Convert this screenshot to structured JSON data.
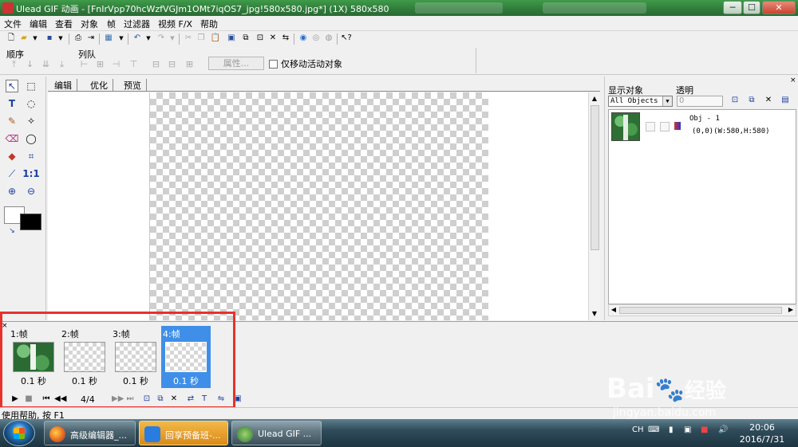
{
  "titlebar": {
    "title": "Ulead GIF 动画 - [FnIrVpp70hcWzfVGJm1OMt7iqOS7_jpg!580x580.jpg*] (1X) 580x580",
    "min_label": "─",
    "max_label": "☐",
    "close_label": "✕"
  },
  "menu": [
    "文件",
    "编辑",
    "查看",
    "对象",
    "帧",
    "过滤器",
    "视频 F/X",
    "帮助"
  ],
  "arrange": {
    "order_label": "顺序",
    "queue_label": "列队",
    "properties_label": "属性...",
    "only_move_label": "仅移动活动对象"
  },
  "edit_tabs": [
    "编辑",
    "优化",
    "预览"
  ],
  "object_manager": {
    "show_label": "显示对象",
    "trans_label": "透明",
    "filter_value": "All Objects",
    "trans_value": "0",
    "object": {
      "name": "Obj - 1",
      "geometry": "(0,0)(W:580,H:580)"
    }
  },
  "frames": [
    {
      "label": "1:帧",
      "delay": "0.1 秒",
      "kind": "photo",
      "active": false
    },
    {
      "label": "2:帧",
      "delay": "0.1 秒",
      "kind": "transparent",
      "active": false
    },
    {
      "label": "3:帧",
      "delay": "0.1 秒",
      "kind": "transparent",
      "active": false
    },
    {
      "label": "4:帧",
      "delay": "0.1 秒",
      "kind": "transparent",
      "active": true
    }
  ],
  "frame_counter": "4/4",
  "status": "使用帮助, 按 F1",
  "taskbar": {
    "items": [
      {
        "label": "高级编辑器_...",
        "style": "normal"
      },
      {
        "label": "回享预备班-...",
        "style": "orange"
      },
      {
        "label": "Ulead GIF ...",
        "style": "active"
      }
    ],
    "ime": "CH",
    "time": "20:06",
    "date": "2016/7/31"
  },
  "watermark": {
    "brand": "Bai",
    "brand2": "经验",
    "url": "jingyan.baidu.com"
  },
  "colors": {
    "accent": "#3f8fe8",
    "highlight": "#e8312a",
    "titlebar": "#2f7a3a"
  }
}
